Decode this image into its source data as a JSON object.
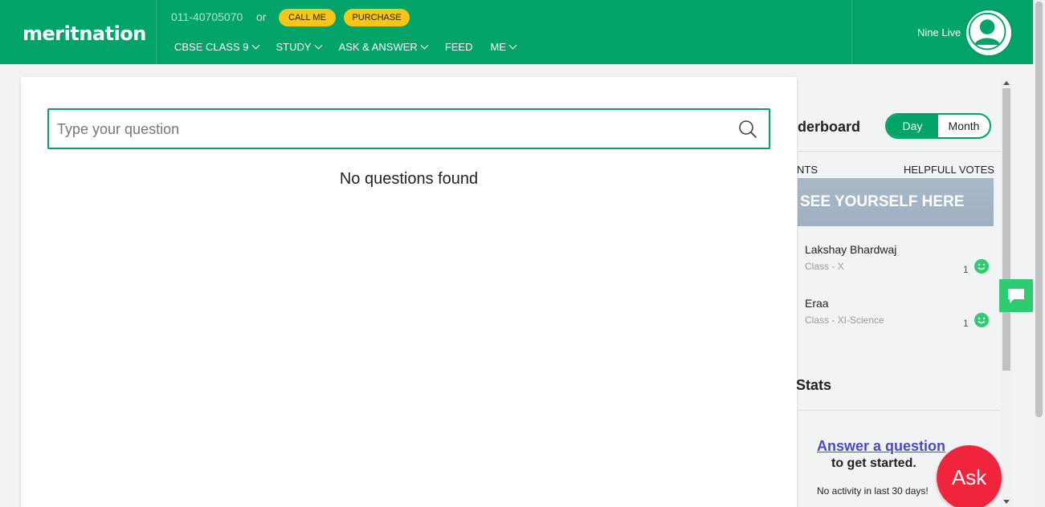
{
  "header": {
    "brand": "meritnation",
    "phone": "011-40705070",
    "or_text": "or",
    "call_me": "CALL ME",
    "purchase": "PURCHASE",
    "nav": [
      {
        "label": "CBSE CLASS 9",
        "has_menu": true
      },
      {
        "label": "STUDY",
        "has_menu": true
      },
      {
        "label": "ASK & ANSWER",
        "has_menu": true
      },
      {
        "label": "FEED",
        "has_menu": false
      },
      {
        "label": "ME",
        "has_menu": true
      }
    ],
    "user_name": "Nine Live"
  },
  "main": {
    "search_placeholder": "Type your question",
    "empty_message": "No questions found"
  },
  "sidebar": {
    "leaderboard_title": "derboard",
    "toggle": {
      "day": "Day",
      "month": "Month",
      "selected": "Day"
    },
    "col_left": "NTS",
    "col_right": "HELPFULL VOTES",
    "banner": "SEE YOURSELF HERE",
    "leaders": [
      {
        "name": "Lakshay Bhardwaj",
        "class": "Class - X",
        "votes": "1"
      },
      {
        "name": "Eraa",
        "class": "Class - XI-Science",
        "votes": "1"
      }
    ],
    "stats_title": "Stats",
    "answer_link": "Answer a question",
    "get_started": "to get started.",
    "no_activity": "No activity in last 30 days!"
  },
  "ask_button": "Ask",
  "colors": {
    "brand_green": "#00a368",
    "pill_yellow": "#f5c518",
    "ask_red": "#f0243a",
    "chat_green": "#2ecc71",
    "link_blue": "#4b49c8"
  }
}
